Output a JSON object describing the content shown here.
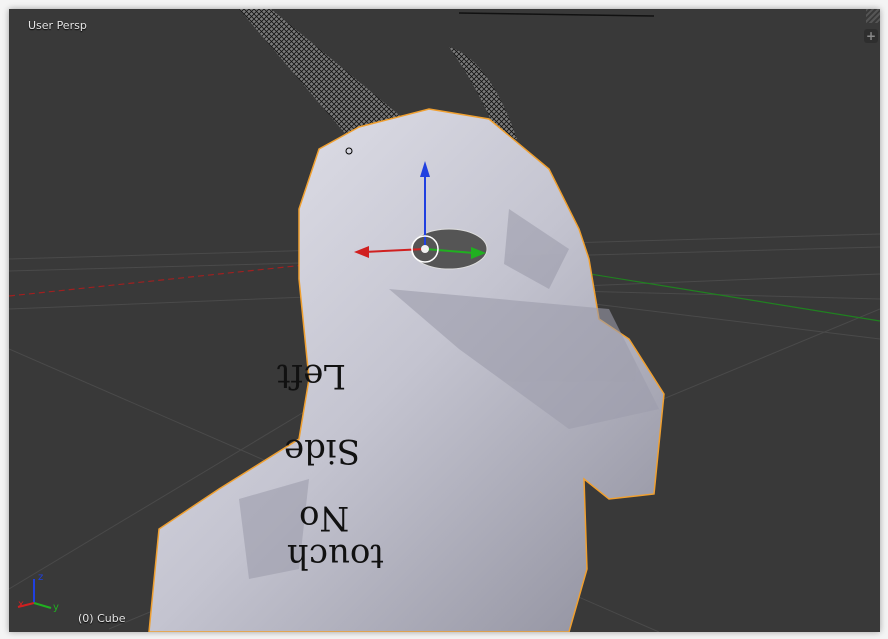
{
  "viewport": {
    "view_label": "User Persp",
    "object_label": "(0) Cube",
    "add_region_button": "+"
  },
  "axis_gizmo": {
    "x": "x",
    "y": "y",
    "z": "z"
  },
  "grease_pencil_notes": [
    "Left",
    "Side",
    "No",
    "touch"
  ],
  "colors": {
    "background": "#393939",
    "selection_outline": "#f0a030",
    "x_axis": "#d02020",
    "y_axis": "#20b020",
    "z_axis": "#2040e0"
  }
}
